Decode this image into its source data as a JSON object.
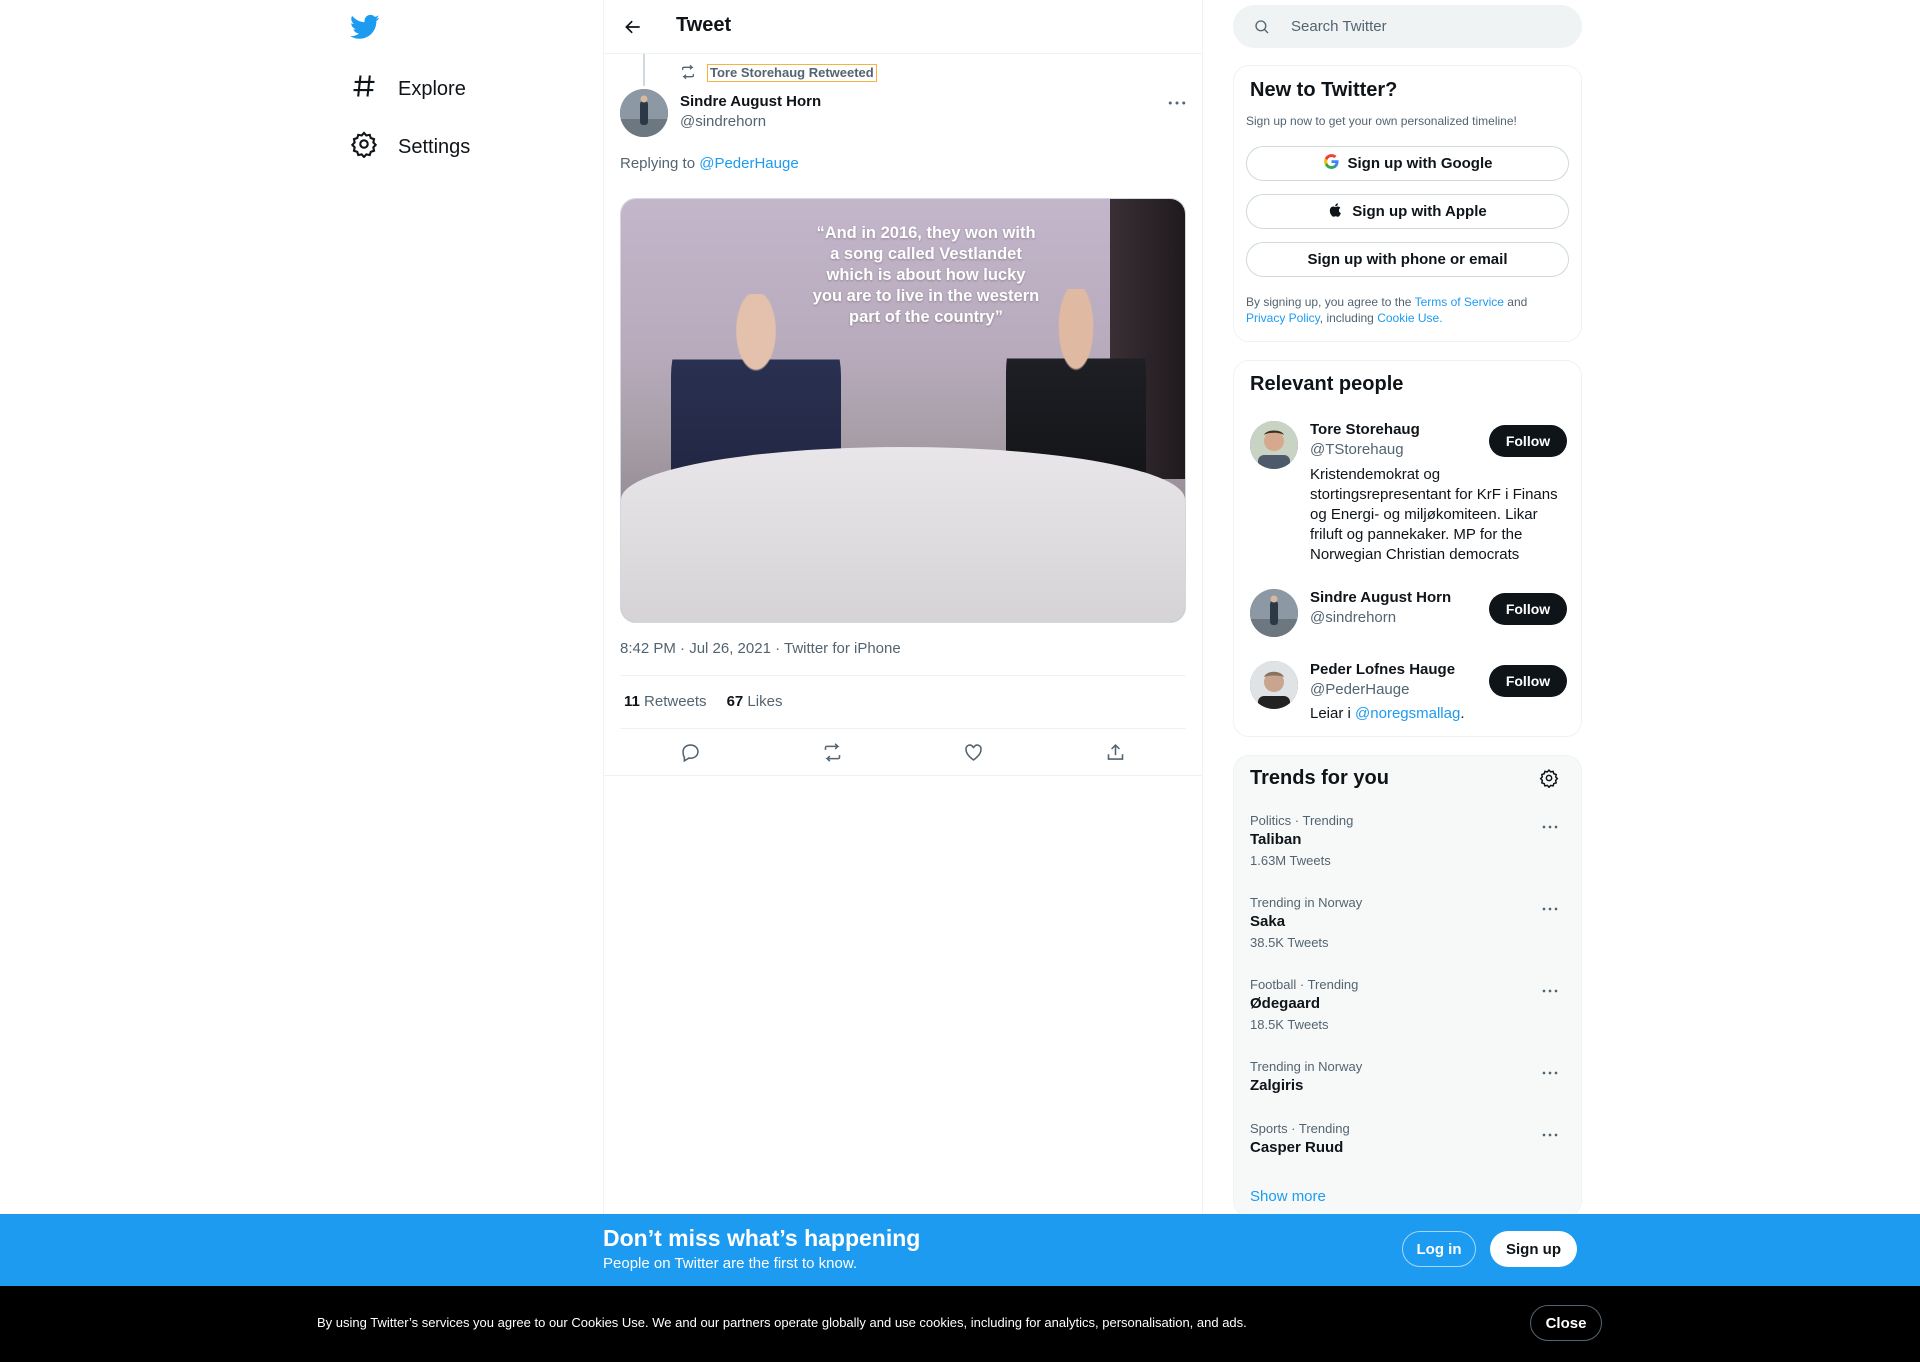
{
  "nav": {
    "items": [
      {
        "label": "Explore",
        "icon": "hashtag-icon"
      },
      {
        "label": "Settings",
        "icon": "gear-icon"
      }
    ]
  },
  "header": {
    "title": "Tweet"
  },
  "tweet": {
    "retweeted_by": "Tore Storehaug Retweeted",
    "author_name": "Sindre August Horn",
    "author_handle": "@sindrehorn",
    "replying_prefix": "Replying to",
    "replying_handle": "@PederHauge",
    "image_caption": "“And in 2016, they won with a song called Vestlandet which is about how lucky you are to live in the western part of the country”",
    "meta": "8:42 PM · Jul 26, 2021 · Twitter for iPhone",
    "retweets_count": "11",
    "retweets_label": "Retweets",
    "likes_count": "67",
    "likes_label": "Likes"
  },
  "search": {
    "placeholder": "Search Twitter"
  },
  "signup_card": {
    "title": "New to Twitter?",
    "subtitle": "Sign up now to get your own personalized timeline!",
    "google": "Sign up with Google",
    "apple": "Sign up with Apple",
    "phone": "Sign up with phone or email",
    "legal_1": "By signing up, you agree to the",
    "terms": "Terms of Service",
    "legal_2": "and",
    "privacy": "Privacy Policy",
    "legal_3": ", including",
    "cookie": "Cookie Use."
  },
  "relevant": {
    "title": "Relevant people",
    "people": [
      {
        "name": "Tore Storehaug",
        "handle": "@TStorehaug",
        "bio": "Kristendemokrat og stortingsrepresentant for KrF i Finans og Energi- og miljøkomiteen. Likar friluft og pannekaker. MP for the Norwegian Christian democrats",
        "follow": "Follow"
      },
      {
        "name": "Sindre August Horn",
        "handle": "@sindrehorn",
        "bio": "",
        "follow": "Follow"
      },
      {
        "name": "Peder Lofnes Hauge",
        "handle": "@PederHauge",
        "bio_prefix": "Leiar i",
        "bio_link": "@noregsmallag",
        "bio_suffix": ".",
        "follow": "Follow"
      }
    ]
  },
  "trends": {
    "title": "Trends for you",
    "items": [
      {
        "meta": "Politics · Trending",
        "name": "Taliban",
        "count": "1.63M Tweets"
      },
      {
        "meta": "Trending in Norway",
        "name": "Saka",
        "count": "38.5K Tweets"
      },
      {
        "meta": "Football · Trending",
        "name": "Ødegaard",
        "count": "18.5K Tweets"
      },
      {
        "meta": "Trending in Norway",
        "name": "Zalgiris",
        "count": ""
      },
      {
        "meta": "Sports · Trending",
        "name": "Casper Ruud",
        "count": ""
      }
    ],
    "show_more": "Show more"
  },
  "bottom_bar": {
    "title": "Don’t miss what’s happening",
    "subtitle": "People on Twitter are the first to know.",
    "login": "Log in",
    "signup": "Sign up"
  },
  "cookie_bar": {
    "text": "By using Twitter’s services you agree to our Cookies Use. We and our partners operate globally and use cookies, including for analytics, personalisation, and ads.",
    "close": "Close"
  },
  "colors": {
    "accent": "#1d9bf0",
    "text": "#0f1419",
    "secondary": "#536471"
  }
}
